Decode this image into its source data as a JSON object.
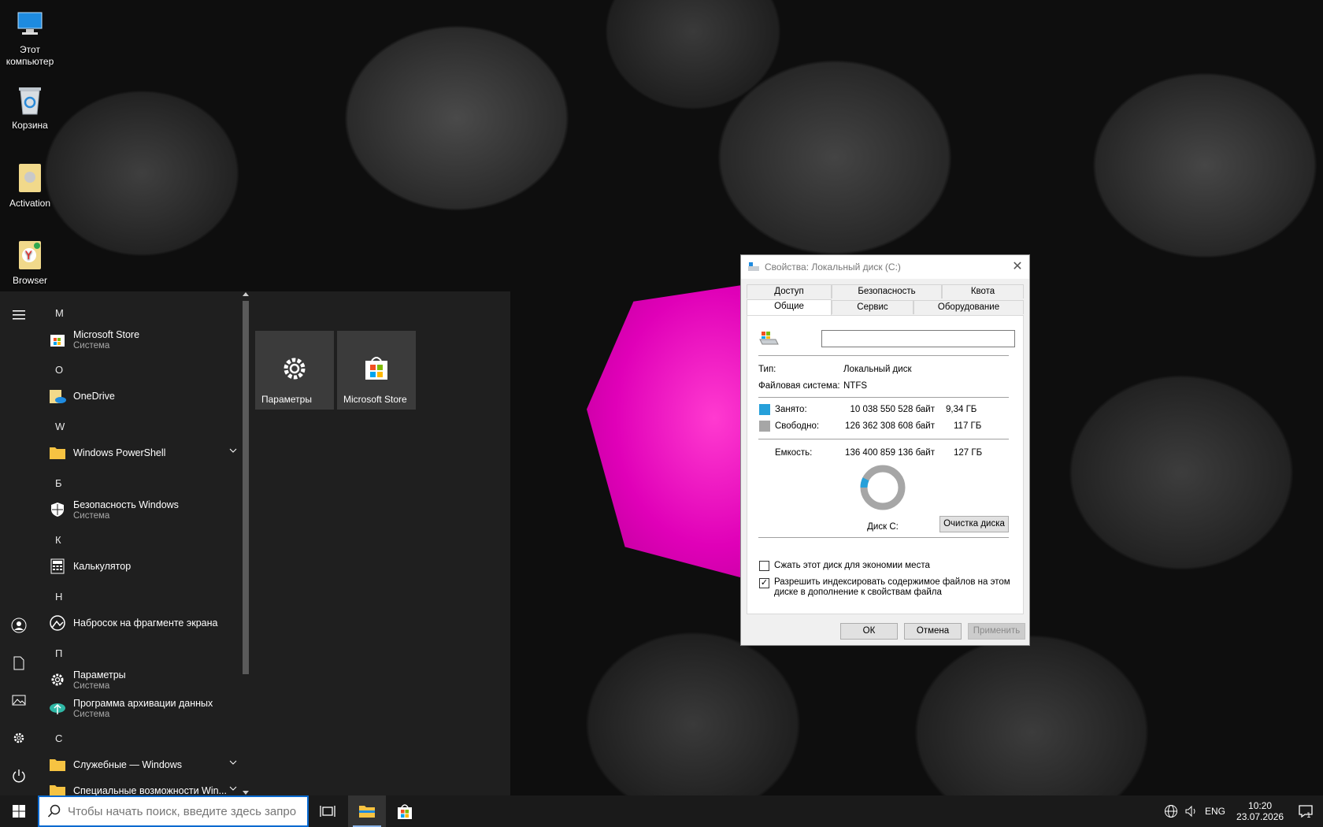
{
  "desktop": {
    "icons": [
      {
        "label": "Этот компьютер"
      },
      {
        "label": "Корзина"
      },
      {
        "label": "Activation"
      },
      {
        "label": "Browser"
      }
    ]
  },
  "start_menu": {
    "apps": [
      {
        "letter": "M"
      },
      {
        "name": "Microsoft Store",
        "sub": "Система"
      },
      {
        "letter": "O"
      },
      {
        "name": "OneDrive"
      },
      {
        "letter": "W"
      },
      {
        "name": "Windows PowerShell"
      },
      {
        "letter": "Б"
      },
      {
        "name": "Безопасность Windows",
        "sub": "Система"
      },
      {
        "letter": "К"
      },
      {
        "name": "Калькулятор"
      },
      {
        "letter": "Н"
      },
      {
        "name": "Набросок на фрагменте экрана"
      },
      {
        "letter": "П"
      },
      {
        "name": "Параметры",
        "sub": "Система"
      },
      {
        "name": "Программа архивации данных",
        "sub": "Система"
      },
      {
        "letter": "С"
      },
      {
        "name": "Служебные — Windows"
      },
      {
        "name": "Специальные возможности Win..."
      }
    ],
    "tiles": [
      {
        "label": "Параметры"
      },
      {
        "label": "Microsoft Store"
      }
    ]
  },
  "dialog": {
    "title": "Свойства: Локальный диск (C:)",
    "tabs_top": [
      "Доступ",
      "Безопасность",
      "Квота"
    ],
    "tabs_bottom": [
      "Общие",
      "Сервис",
      "Оборудование"
    ],
    "name_value": "",
    "type_label": "Тип:",
    "type_value": "Локальный диск",
    "fs_label": "Файловая система:",
    "fs_value": "NTFS",
    "used_label": "Занято:",
    "used_bytes": "10 038 550 528 байт",
    "used_gb": "9,34 ГБ",
    "free_label": "Свободно:",
    "free_bytes": "126 362 308 608 байт",
    "free_gb": "117 ГБ",
    "capacity_label": "Емкость:",
    "capacity_bytes": "136 400 859 136 байт",
    "capacity_gb": "127 ГБ",
    "used_fraction": 0.0736,
    "used_color": "#26a0da",
    "free_color": "#a6a6a6",
    "disk_label": "Диск C:",
    "cleanup_button": "Очистка диска",
    "compress_label": "Сжать этот диск для экономии места",
    "compress_checked": false,
    "index_label": "Разрешить индексировать содержимое файлов на этом диске в дополнение к свойствам файла",
    "index_checked": true,
    "ok_button": "ОК",
    "cancel_button": "Отмена",
    "apply_button": "Применить"
  },
  "taskbar": {
    "search_placeholder": "Чтобы начать поиск, введите здесь запрос",
    "language": "ENG",
    "time": "10:20",
    "date": "23.07.2026"
  },
  "colors": {
    "accent": "#0a6ad0",
    "umbrella_pink": "#e000b8"
  }
}
